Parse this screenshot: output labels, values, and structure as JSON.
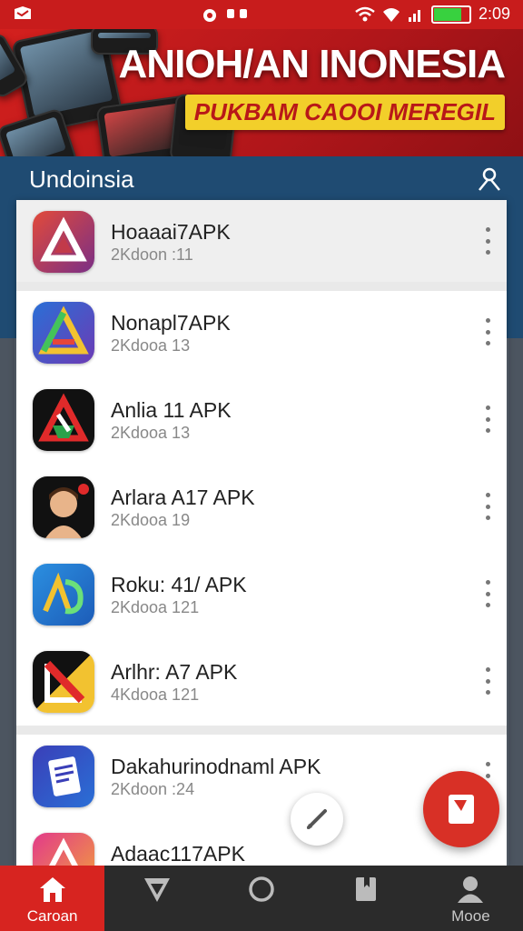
{
  "status_bar": {
    "time": "2:09",
    "battery_level": 0.75
  },
  "banner": {
    "title": "ANIOH/AN INONESIA",
    "subtitle": "PUKBAM CAOOI MEREGIL"
  },
  "app_bar": {
    "title": "Undoinsia",
    "action_icon": "user-icon"
  },
  "apps": [
    {
      "name": "Hoaaai7APK",
      "meta": "2Kdoon :11",
      "icon": "red-triangle-icon"
    },
    {
      "name": "Nonapl7APK",
      "meta": "2Kdooa 13",
      "icon": "blue-gradient-triangle-icon"
    },
    {
      "name": "Anlia 11 APK",
      "meta": "2Kdooa 13",
      "icon": "dark-red-triangle-icon"
    },
    {
      "name": "Arlara A17 APK",
      "meta": "2Kdooa 19",
      "icon": "avatar-character-icon"
    },
    {
      "name": "Roku: 41/ APK",
      "meta": "2Kdooa 121",
      "icon": "blue-ad-icon"
    },
    {
      "name": "Arlhr: A7 APK",
      "meta": "4Kdooa 121",
      "icon": "yellow-red-triangle-icon"
    },
    {
      "name": "Dakahurinodnaml APK",
      "meta": "2Kdoon :24",
      "icon": "document-icon"
    },
    {
      "name": "Adaac117APK",
      "meta": "",
      "icon": "pink-triangle-icon"
    }
  ],
  "bottom_nav": [
    {
      "label": "Caroan",
      "icon": "home-icon",
      "active": true
    },
    {
      "label": "",
      "icon": "send-icon",
      "active": false
    },
    {
      "label": "",
      "icon": "circle-icon",
      "active": false
    },
    {
      "label": "",
      "icon": "bookmark-icon",
      "active": false
    },
    {
      "label": "Mooe",
      "icon": "profile-icon",
      "active": false
    }
  ],
  "colors": {
    "accent": "#d72420",
    "app_bar": "#1f4b72",
    "banner_yellow": "#f2cf2a"
  }
}
